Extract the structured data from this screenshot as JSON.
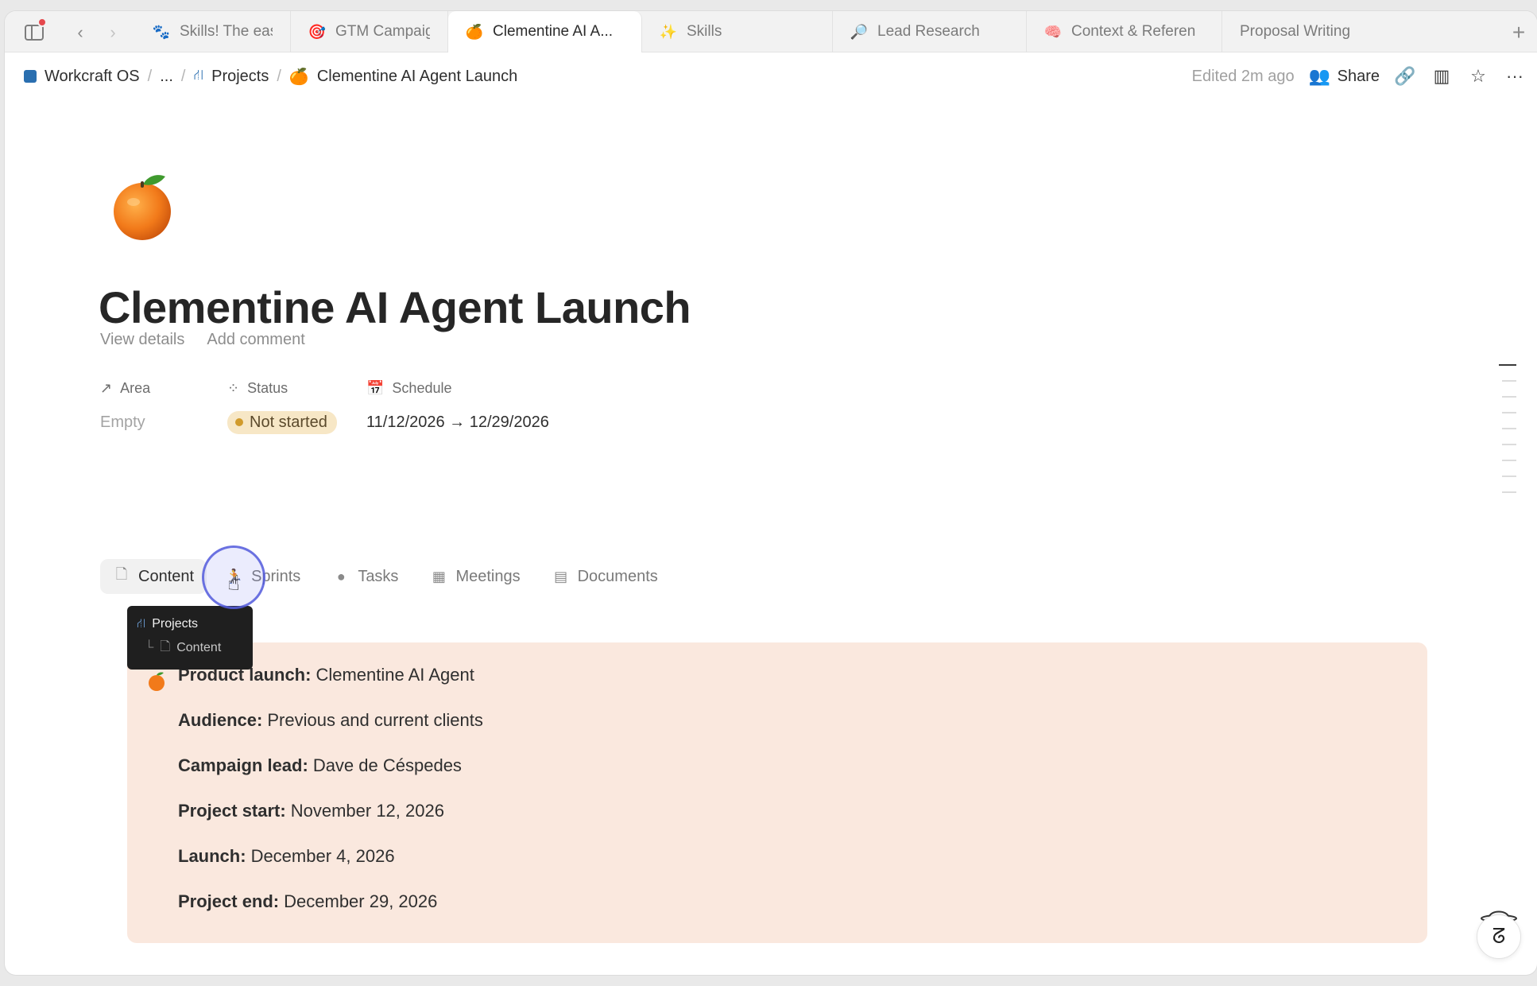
{
  "browser": {
    "tabs": [
      {
        "label": "Skills! The easiest",
        "icon": "pawprint-icon"
      },
      {
        "label": "GTM Campaign Pr",
        "icon": "target-icon"
      },
      {
        "label": "Clementine AI A...",
        "icon": "orange-icon",
        "active": true
      },
      {
        "label": "Skills",
        "icon": "magic-wand-icon"
      },
      {
        "label": "Lead Research",
        "icon": "magnifier-icon"
      },
      {
        "label": "Context & Referen",
        "icon": "brain-icon"
      },
      {
        "label": "Proposal Writing",
        "icon": ""
      }
    ],
    "new_tab": "+"
  },
  "breadcrumb": {
    "workspace": "Workcraft OS",
    "ellipsis": "...",
    "projects": "Projects",
    "current": "Clementine AI Agent Launch"
  },
  "topbar": {
    "edited": "Edited 2m ago",
    "share": "Share"
  },
  "page": {
    "title": "Clementine AI Agent Launch",
    "view_details": "View details",
    "add_comment": "Add comment"
  },
  "properties": {
    "area": {
      "label": "Area",
      "value": "Empty"
    },
    "status": {
      "label": "Status",
      "value": "Not started"
    },
    "schedule": {
      "label": "Schedule",
      "value": "11/12/2026 → 12/29/2026"
    }
  },
  "view_tabs": [
    {
      "label": "Content",
      "icon": "document-icon",
      "active": true
    },
    {
      "label": "Sprints",
      "icon": "runner-icon"
    },
    {
      "label": "Tasks",
      "icon": "circle-icon"
    },
    {
      "label": "Meetings",
      "icon": "calendar-icon"
    },
    {
      "label": "Documents",
      "icon": "file-icon"
    }
  ],
  "tooltip": {
    "parent": "Projects",
    "child": "Content"
  },
  "callout": {
    "lines": [
      {
        "label": "Product launch:",
        "value": "Clementine AI Agent"
      },
      {
        "label": "Audience:",
        "value": "Previous and current clients"
      },
      {
        "label": "Campaign lead:",
        "value": "Dave de Céspedes"
      },
      {
        "label": "Project start:",
        "value": "November 12, 2026"
      },
      {
        "label": "Launch:",
        "value": "December 4, 2026"
      },
      {
        "label": "Project end:",
        "value": "December 29, 2026"
      }
    ]
  },
  "colors": {
    "callout_bg": "#fae8de",
    "status_badge_bg": "#f7e7c6",
    "status_dot": "#d19b2c",
    "cursor_ring": "#545cdc"
  }
}
